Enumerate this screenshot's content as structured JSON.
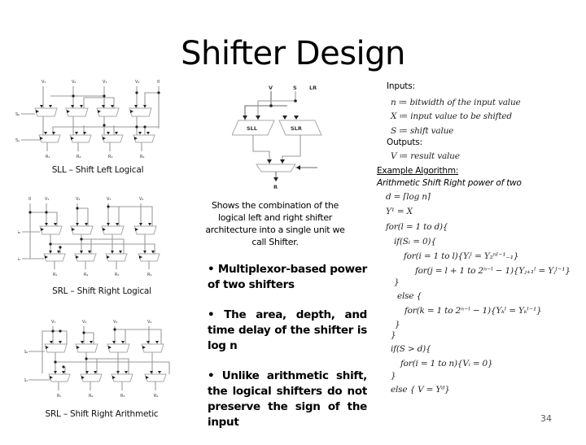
{
  "slide": {
    "title": "Shifter Design",
    "page_number": "34"
  },
  "diagrams": {
    "sll": {
      "caption": "SLL – Shift Left Logical",
      "inputs": [
        "V₁",
        "V₂",
        "V₃",
        "V₄",
        "0"
      ],
      "selects": [
        "S₀",
        "S₁"
      ],
      "outputs": [
        "R₁",
        "R₂",
        "R₃",
        "R₄"
      ]
    },
    "shifter": {
      "labels": {
        "v": "V",
        "s": "S",
        "lr": "LR",
        "sll": "SLL",
        "slr": "SLR",
        "r": "R"
      },
      "caption": "Shows the combination of the logical left and right shifter architecture into a single unit we call Shifter."
    },
    "srl": {
      "caption": "SRL – Shift Right Logical",
      "inputs": [
        "0",
        "V₁",
        "V₂",
        "V₃",
        "V₄"
      ],
      "selects": [
        "S₀",
        "S₁"
      ],
      "outputs": [
        "R₁",
        "R₂",
        "R₃",
        "R₄"
      ]
    },
    "sra": {
      "caption": "SRL – Shift Right Arithmetic",
      "inputs": [
        "V₁",
        "V₂",
        "V₃",
        "V₄"
      ],
      "selects": [
        "S₀",
        "S₁"
      ],
      "outputs": [
        "R₁",
        "R₂",
        "R₃",
        "R₄"
      ]
    }
  },
  "bullets": [
    "• Multiplexor-based power of two shifters",
    "• The area, depth, and time delay of the shifter is log n",
    "• Unlike arithmetic shift, the logical shifters do not preserve the sign of the input"
  ],
  "algorithm": {
    "inputs_heading": "Inputs:",
    "inputs": [
      "n ≔ bitwidth of the input value",
      "X ≔ input value to be shifted",
      "S ≔ shift value"
    ],
    "outputs_heading": "Outputs:",
    "outputs": [
      "V ≔ result value"
    ],
    "example_heading": "Example Algorithm:",
    "example_subtitle": "Arithmetic Shift Right power of two",
    "lines": [
      "d = ⌈log n⌉",
      "Y¹ = X",
      "for(l = 1 to d){",
      "if(Sₗ = 0){",
      "for(i = 1 to l){Yᵢˡ = Y₂ⁿˡ⁻¹₋₁}",
      "for(j = l + 1 to 2ⁿ⁻ˡ − 1){Yⱼ₊₁ˡ = Yⱼˡ⁻¹}",
      "}",
      "else {",
      "for(k = 1 to 2ⁿ⁻ˡ − 1){Yₖˡ = Yₖˡ⁻¹}",
      "}",
      "}",
      "if(S > d){",
      "for(i = 1 to n){Vᵢ = 0}",
      "}",
      "else { V = Yᵈ}"
    ]
  }
}
